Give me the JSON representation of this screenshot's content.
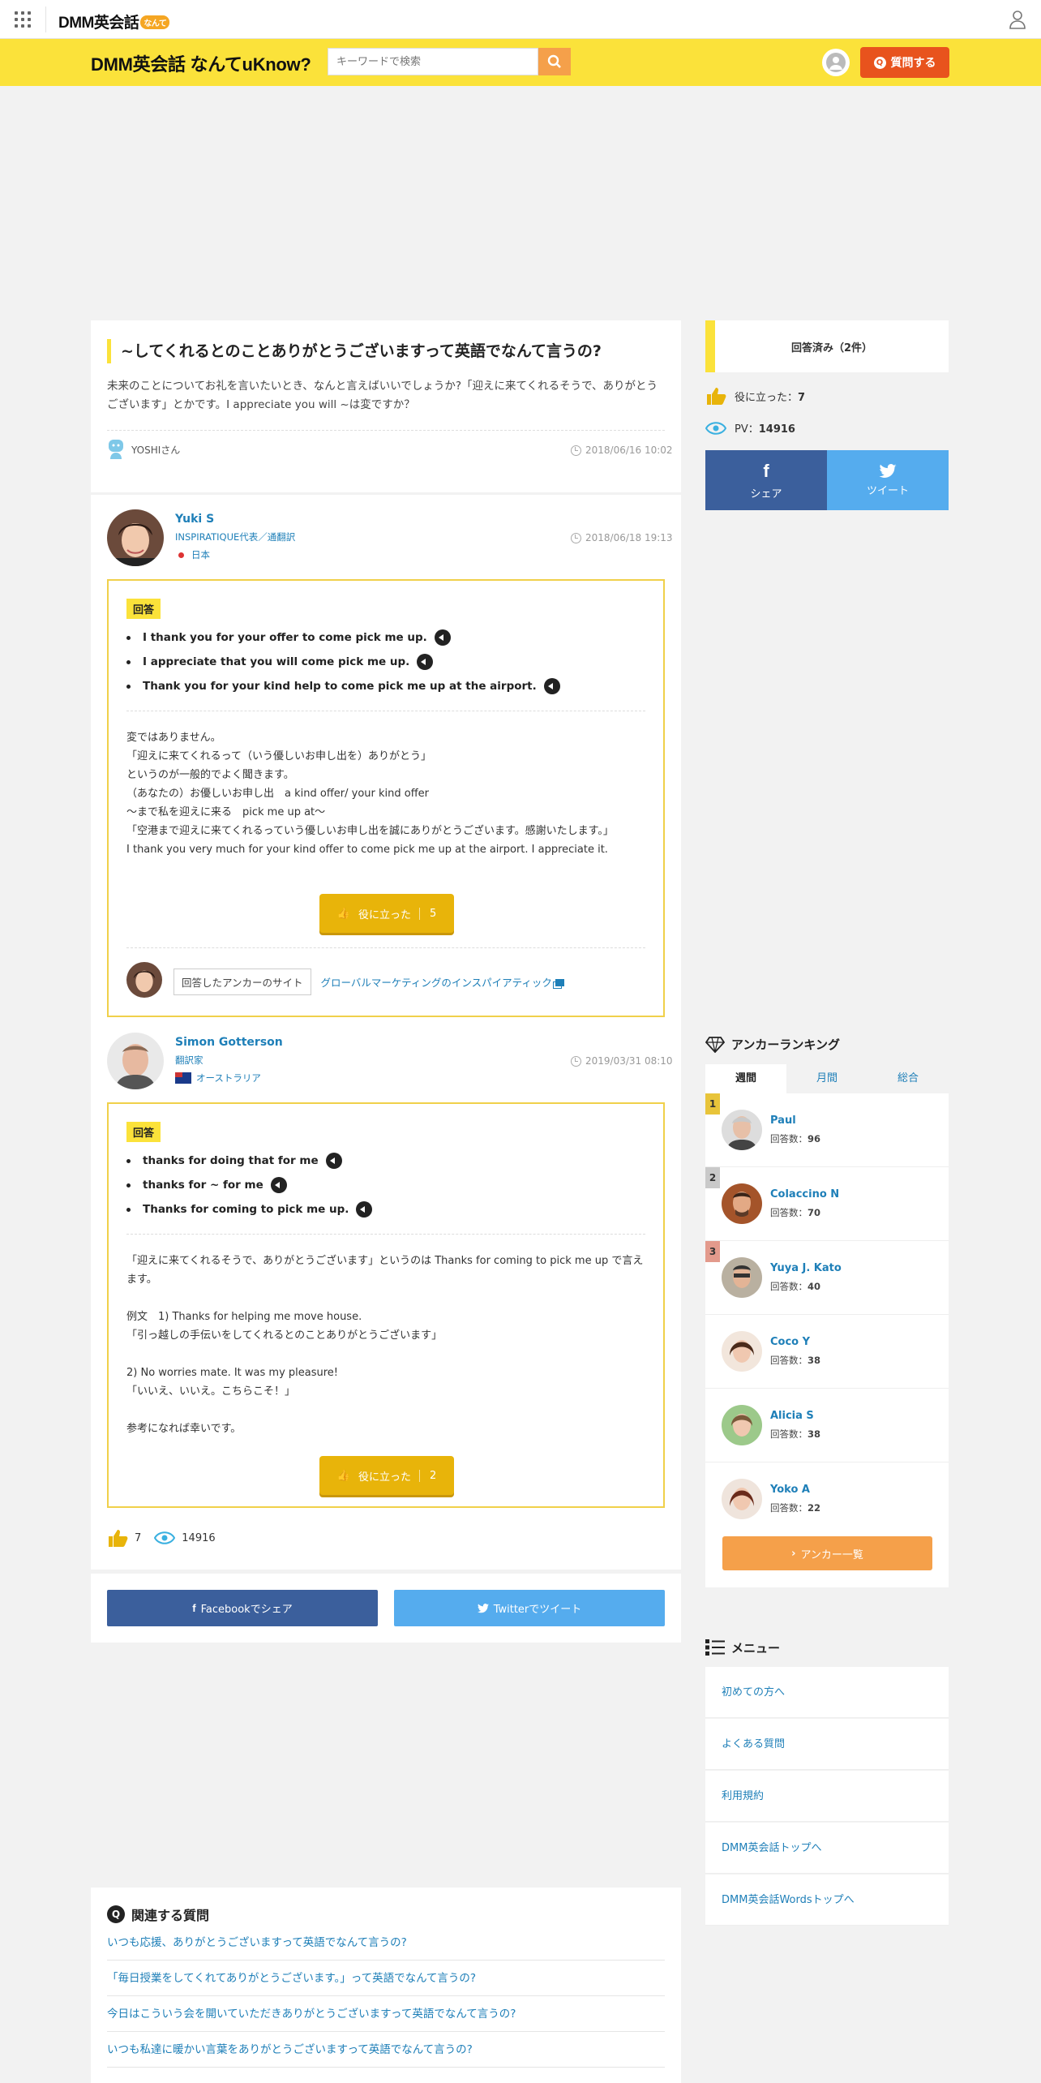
{
  "header": {
    "logo": "DMM英会話",
    "logo_badge": "なんて",
    "site_title": "DMM英会話 なんてuKnow?",
    "search_placeholder": "キーワードで検索",
    "ask_button": "質問する"
  },
  "question": {
    "title": "~してくれるとのことありがとうございますって英語でなんて言うの?",
    "body": "未来のことについてお礼を言いたいとき、なんと言えばいいでしょうか?「迎えに来てくれるそうで、ありがとうございます」とかです。I appreciate you will ~は変ですか？",
    "asker": "YOSHIさん",
    "date": "2018/06/16 10:02"
  },
  "answers": [
    {
      "name": "Yuki S",
      "role": "INSPIRATIQUE代表／通翻訳",
      "country": "日本",
      "date": "2018/06/18 19:13",
      "tag": "回答",
      "phrases": [
        "I thank you for your offer to come pick me up.",
        "I appreciate that you will come pick me up.",
        "Thank you for your kind help to come pick me up at the airport."
      ],
      "explanation": "変ではありません。\n「迎えに来てくれるって（いう優しいお申し出を）ありがとう」\nというのが一般的でよく聞きます。\n（あなたの）お優しいお申し出　a kind offer/ your kind offer\n〜まで私を迎えに来る　pick me up at〜\n「空港まで迎えに来てくれるっていう優しいお申し出を誠にありがとうございます。感謝いたします。」\nI thank you very much for your kind offer to come pick me up at the airport. I appreciate it.",
      "helpful_label": "役に立った",
      "helpful_count": "5",
      "site_label": "回答したアンカーのサイト",
      "site_link": "グローバルマーケティングのインスパイアティック"
    },
    {
      "name": "Simon Gotterson",
      "role": "翻訳家",
      "country": "オーストラリア",
      "date": "2019/03/31 08:10",
      "tag": "回答",
      "phrases": [
        "thanks for doing that for me",
        "thanks for ~ for me",
        "Thanks for coming to pick me up."
      ],
      "explanation": "「迎えに来てくれるそうで、ありがとうございます」というのは Thanks for coming to pick me up で言えます。\n\n例文　1) Thanks for helping me move house.\n「引っ越しの手伝いをしてくれるとのことありがとうございます」\n\n2) No worries mate. It was my pleasure!\n「いいえ、いいえ。こちらこそ！」\n\n参考になれば幸いです。",
      "helpful_label": "役に立った",
      "helpful_count": "2"
    }
  ],
  "stats": {
    "likes": "7",
    "views": "14916"
  },
  "share": {
    "facebook": "Facebookでシェア",
    "twitter": "Twitterでツイート"
  },
  "sidebar": {
    "answered": "回答済み（2件）",
    "helpful_label": "役に立った：",
    "helpful_value": "7",
    "pv_label": "PV：",
    "pv_value": "14916",
    "share_fb": "シェア",
    "share_tw": "ツイート",
    "ranking_title": "アンカーランキング",
    "tabs": [
      "週間",
      "月間",
      "総合"
    ],
    "ranks": [
      {
        "num": "1",
        "name": "Paul",
        "count_label": "回答数：",
        "count": "96"
      },
      {
        "num": "2",
        "name": "Colaccino N",
        "count_label": "回答数：",
        "count": "70"
      },
      {
        "num": "3",
        "name": "Yuya J. Kato",
        "count_label": "回答数：",
        "count": "40"
      },
      {
        "num": "",
        "name": "Coco Y",
        "count_label": "回答数：",
        "count": "38"
      },
      {
        "num": "",
        "name": "Alicia S",
        "count_label": "回答数：",
        "count": "38"
      },
      {
        "num": "",
        "name": "Yoko A",
        "count_label": "回答数：",
        "count": "22"
      }
    ],
    "anchor_list": "アンカー一覧",
    "menu_title": "メニュー",
    "menu": [
      "初めての方へ",
      "よくある質問",
      "利用規約",
      "DMM英会話トップへ",
      "DMM英会話Wordsトップへ"
    ]
  },
  "related": {
    "title": "関連する質問",
    "items": [
      "いつも応援、ありがとうございますって英語でなんて言うの?",
      "「毎日授業をしてくれてありがとうございます。」って英語でなんて言うの?",
      "今日はこういう会を開いていただきありがとうございますって英語でなんて言うの?",
      "いつも私達に暖かい言葉をありがとうございますって英語でなんて言うの?"
    ]
  },
  "colors": {
    "yellow": "#fbe23a",
    "orange": "#e8531d",
    "link": "#1e7fb8",
    "facebook": "#3b5f9c",
    "twitter": "#55acee",
    "helpful": "#e8b40a"
  }
}
